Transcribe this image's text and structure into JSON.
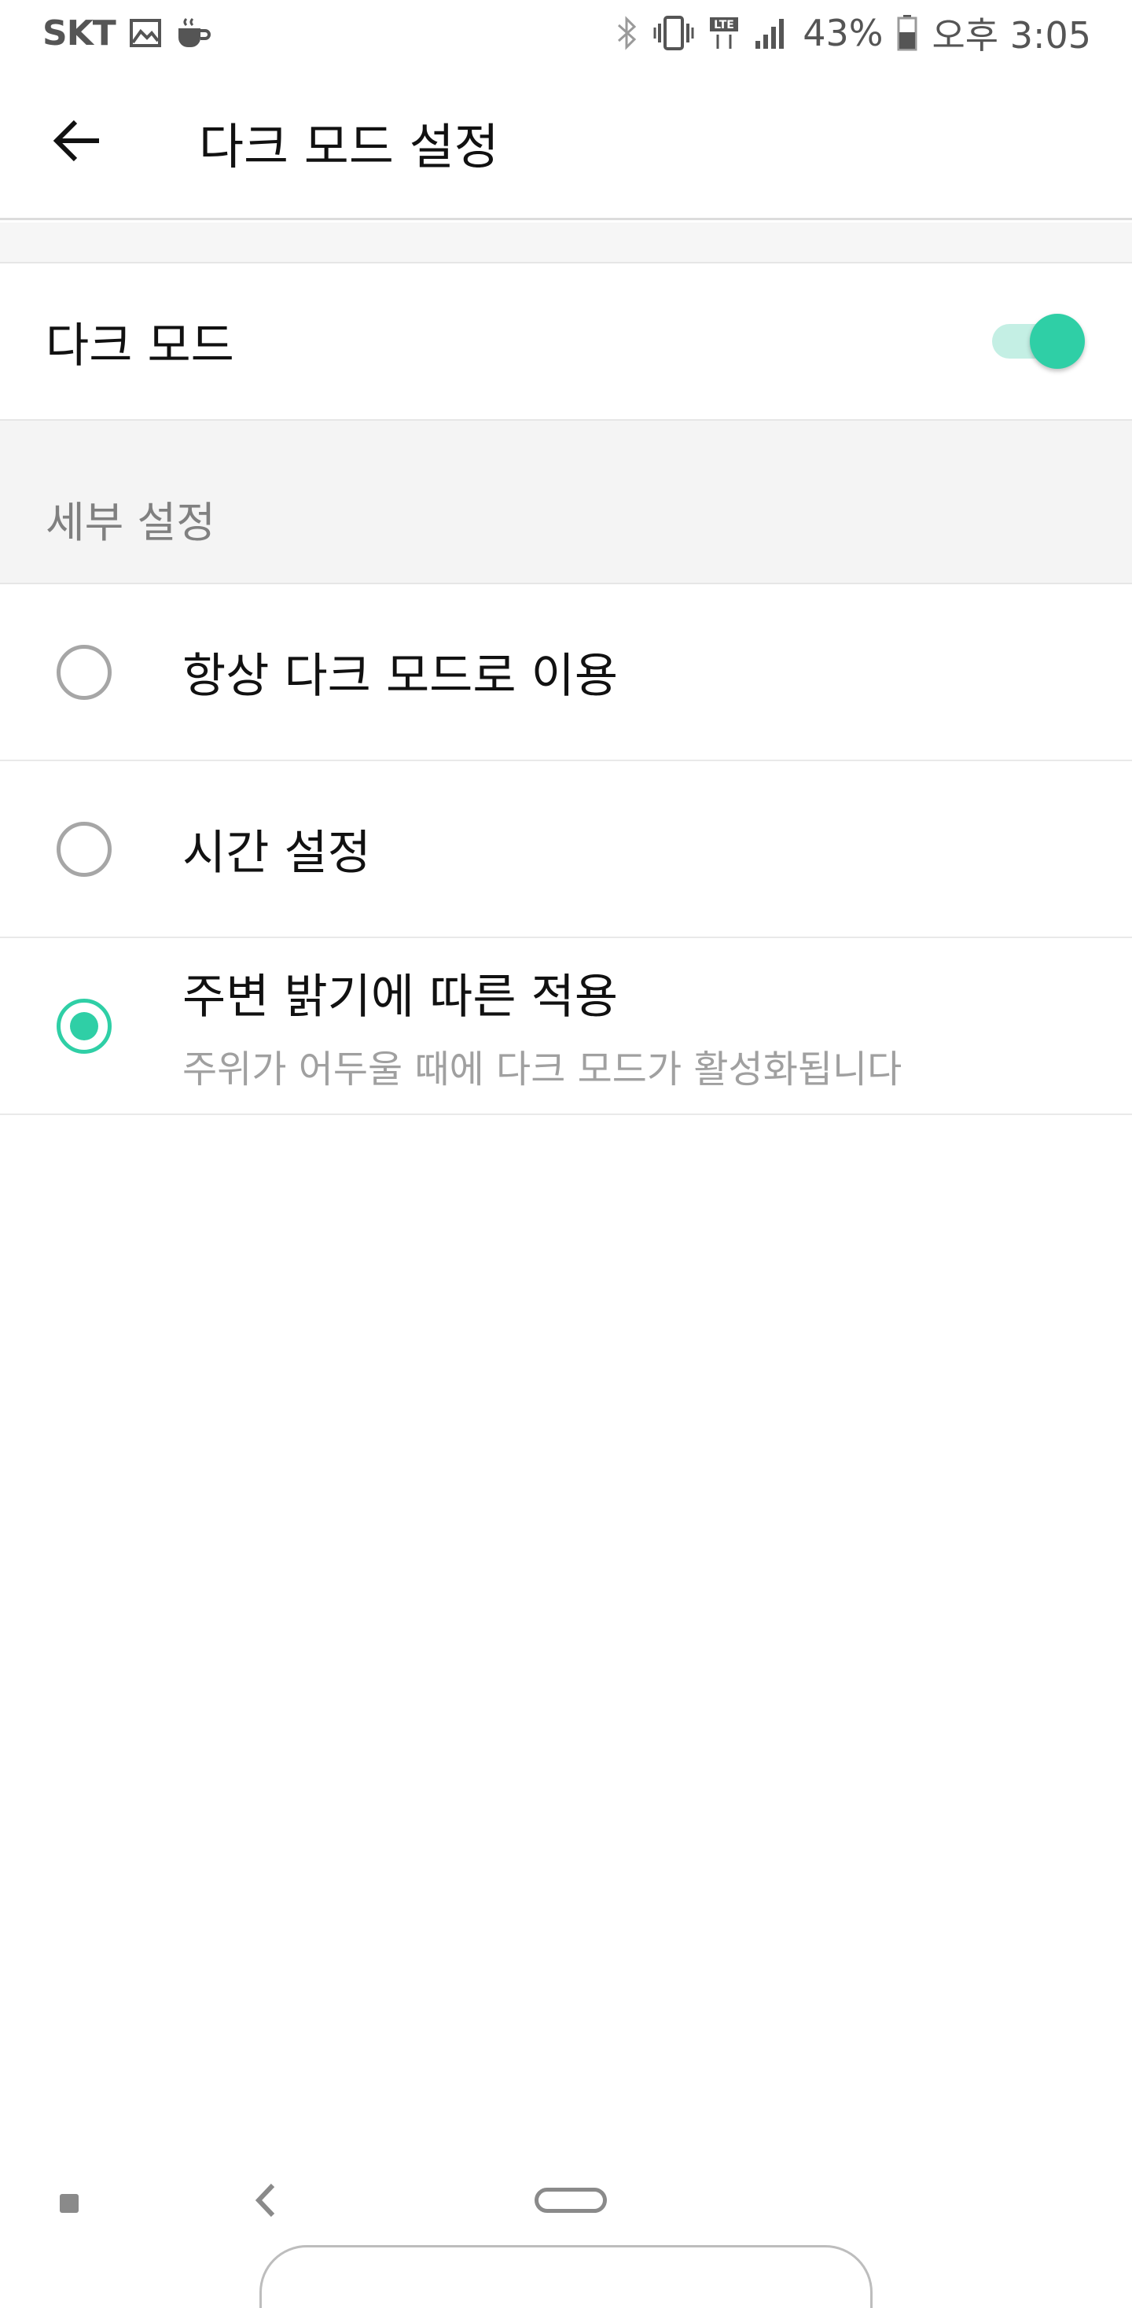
{
  "status_bar": {
    "carrier": "SKT",
    "left_icons": [
      "gallery-icon",
      "coffee-icon"
    ],
    "right_icons": [
      "bluetooth-icon",
      "vibrate-icon",
      "lte-icon",
      "signal-icon",
      "battery-icon"
    ],
    "battery_percent": "43%",
    "time": "오후 3:05"
  },
  "header": {
    "title": "다크 모드 설정",
    "back_icon": "arrow-left-icon"
  },
  "dark_mode": {
    "label": "다크 모드",
    "enabled": true
  },
  "details_section": {
    "title": "세부 설정",
    "options": [
      {
        "label": "항상 다크 모드로 이용",
        "selected": false
      },
      {
        "label": "시간 설정",
        "selected": false
      },
      {
        "label": "주변 밝기에 따른 적용",
        "description": "주위가 어두울 때에 다크 모드가 활성화됩니다",
        "selected": true
      }
    ]
  },
  "colors": {
    "accent": "#2fcfa6",
    "accent_light": "#c4efe4",
    "section_bg": "#f4f4f4"
  },
  "nav_bar": {
    "icons": [
      "recent-apps-icon",
      "back-icon",
      "home-icon"
    ]
  }
}
